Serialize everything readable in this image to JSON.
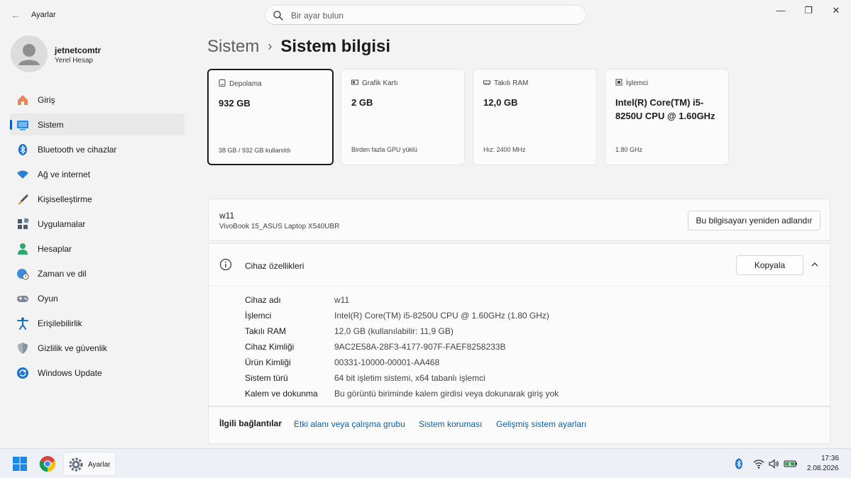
{
  "app": {
    "title": "Ayarlar"
  },
  "search": {
    "placeholder": "Bir ayar bulun"
  },
  "user": {
    "name": "jetnetcomtr",
    "account_type": "Yerel Hesap"
  },
  "sidebar": {
    "items": [
      {
        "label": "Giriş",
        "icon": "home-icon"
      },
      {
        "label": "Sistem",
        "icon": "monitor-icon",
        "active": true
      },
      {
        "label": "Bluetooth ve cihazlar",
        "icon": "bluetooth-icon"
      },
      {
        "label": "Ağ ve internet",
        "icon": "wifi-icon"
      },
      {
        "label": "Kişiselleştirme",
        "icon": "brush-icon"
      },
      {
        "label": "Uygulamalar",
        "icon": "apps-icon"
      },
      {
        "label": "Hesaplar",
        "icon": "person-icon"
      },
      {
        "label": "Zaman ve dil",
        "icon": "globe-clock-icon"
      },
      {
        "label": "Oyun",
        "icon": "gamepad-icon"
      },
      {
        "label": "Erişilebilirlik",
        "icon": "accessibility-icon"
      },
      {
        "label": "Gizlilik ve güvenlik",
        "icon": "shield-icon"
      },
      {
        "label": "Windows Update",
        "icon": "update-icon"
      }
    ]
  },
  "breadcrumb": {
    "parent": "Sistem",
    "separator": "›",
    "current": "Sistem bilgisi"
  },
  "cards": [
    {
      "title": "Depolama",
      "value": "932 GB",
      "sub": "38 GB / 932 GB kullanıldı",
      "icon": "storage-icon",
      "selected": true
    },
    {
      "title": "Grafik Kartı",
      "value": "2 GB",
      "sub": "Birden fazla GPU yüklü",
      "icon": "gpu-icon"
    },
    {
      "title": "Takılı RAM",
      "value": "12,0 GB",
      "sub": "Hız: 2400 MHz",
      "icon": "ram-icon"
    },
    {
      "title": "İşlemci",
      "value": "Intel(R) Core(TM) i5-8250U CPU @ 1.60GHz",
      "sub": "1.80 GHz",
      "icon": "cpu-icon"
    }
  ],
  "device": {
    "name": "w11",
    "model": "VivoBook 15_ASUS Laptop X540UBR",
    "rename_button": "Bu bilgisayarı yeniden adlandır"
  },
  "specs": {
    "title": "Cihaz özellikleri",
    "copy_button": "Kopyala",
    "rows": [
      {
        "key": "Cihaz adı",
        "value": "w11"
      },
      {
        "key": "İşlemci",
        "value": "Intel(R) Core(TM) i5-8250U CPU @ 1.60GHz (1.80 GHz)"
      },
      {
        "key": "Takılı RAM",
        "value": "12,0 GB (kullanılabilir: 11,9 GB)"
      },
      {
        "key": "Cihaz Kimliği",
        "value": "9AC2E58A-28F3-4177-907F-FAEF8258233B"
      },
      {
        "key": "Ürün Kimliği",
        "value": "00331-10000-00001-AA468"
      },
      {
        "key": "Sistem türü",
        "value": "64 bit işletim sistemi, x64 tabanlı işlemci"
      },
      {
        "key": "Kalem ve dokunma",
        "value": "Bu görüntü biriminde kalem girdisi veya dokunarak giriş yok"
      }
    ]
  },
  "related": {
    "label": "İlgili bağlantılar",
    "links": [
      "Etki alanı veya çalışma grubu",
      "Sistem koruması",
      "Gelişmiş sistem ayarları"
    ]
  },
  "taskbar": {
    "app_label": "Ayarlar",
    "time": "17:36",
    "date": "2.08.2026"
  },
  "colors": {
    "accent": "#005fb8",
    "link": "#0a5fa8"
  }
}
